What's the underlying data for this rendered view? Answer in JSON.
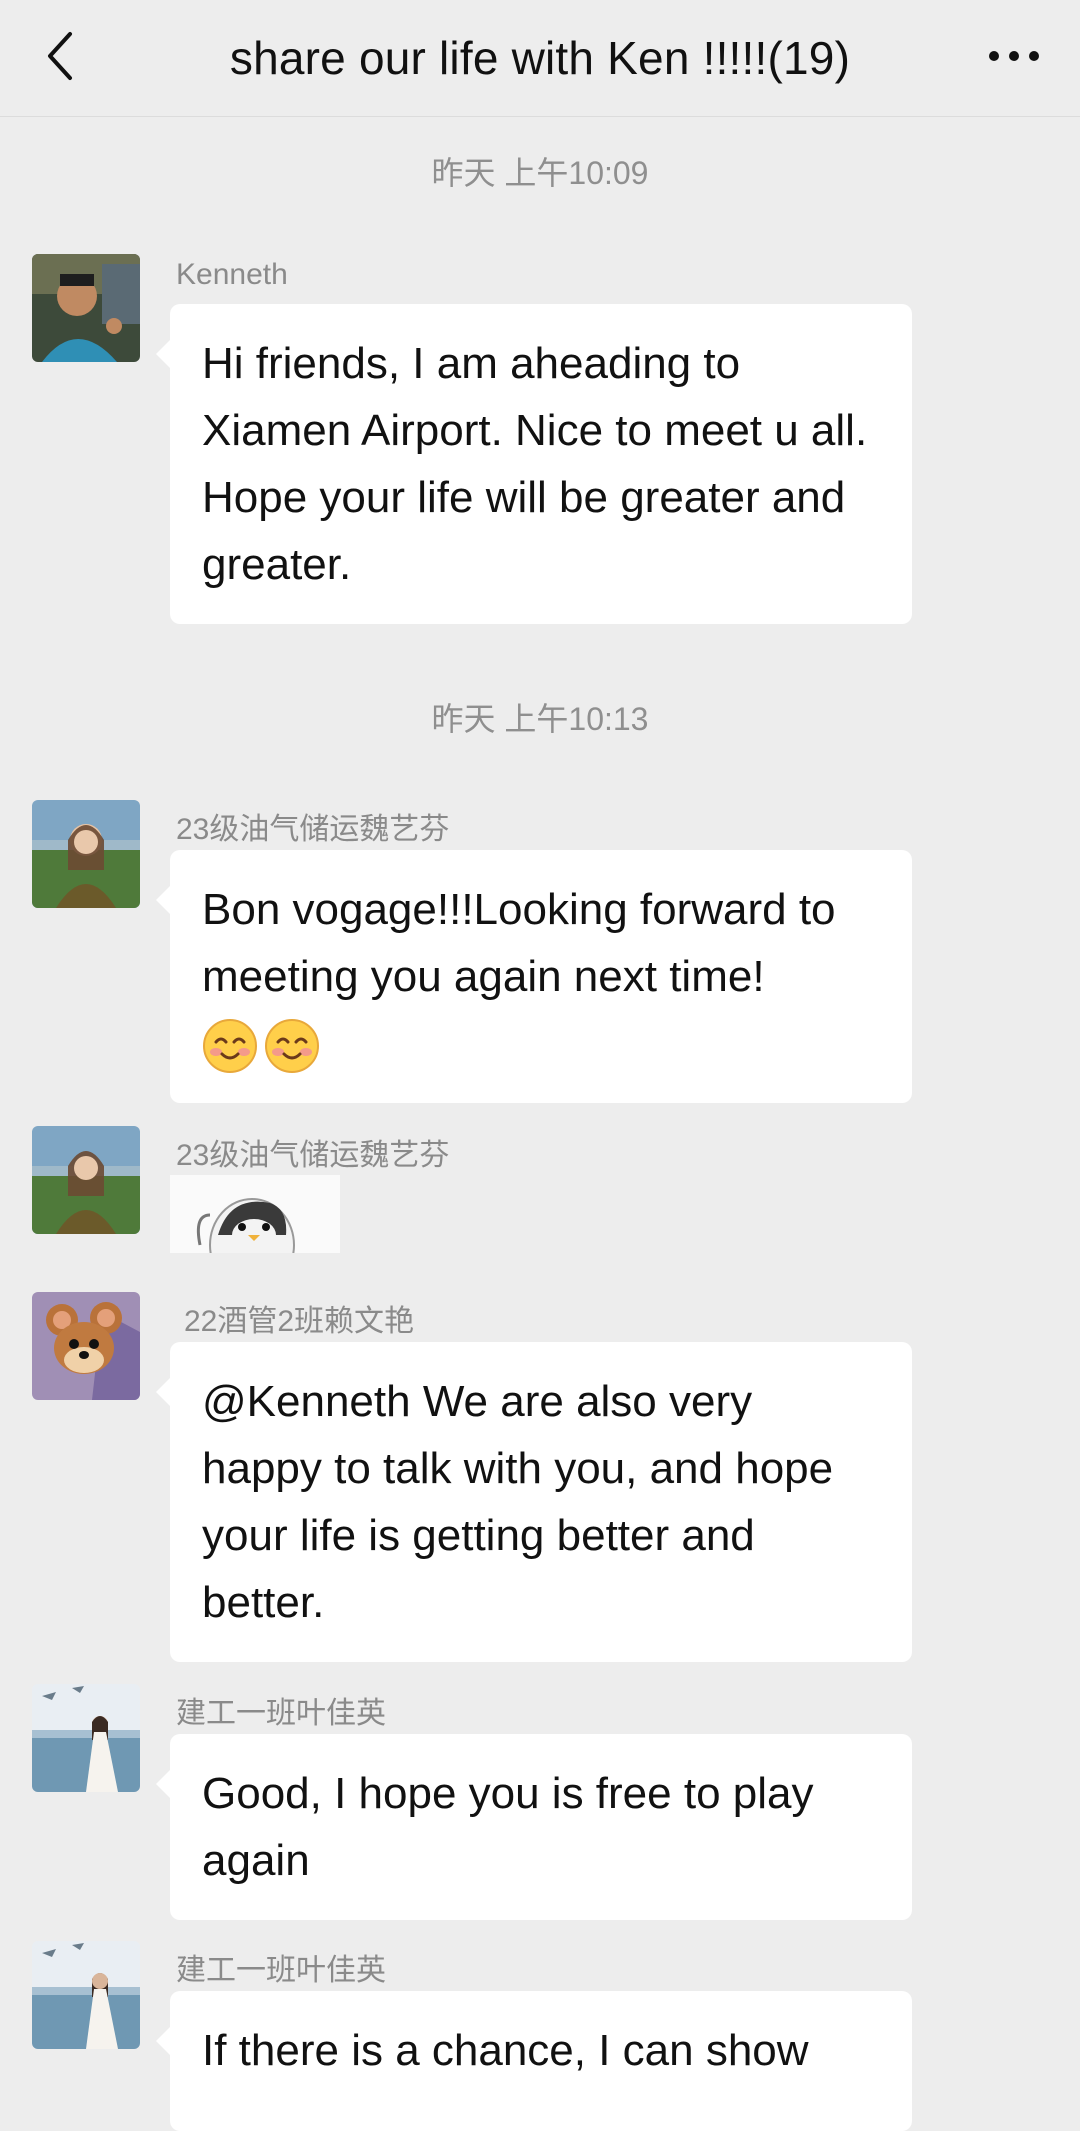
{
  "header": {
    "title": "share our life with Ken !!!!!(19)"
  },
  "timestamps": [
    "昨天 上午10:09",
    "昨天 上午10:13"
  ],
  "messages": [
    {
      "sender": "Kenneth",
      "text": "Hi friends, I am aheading to Xiamen Airport. Nice to meet u all. Hope your life will be greater and greater."
    },
    {
      "sender": "23级油气储运魏艺芬",
      "text": "Bon vogage!!!Looking forward to meeting  you  again next time!"
    },
    {
      "sender": "23级油气储运魏艺芬",
      "sticker": "penguin-sticker"
    },
    {
      "sender": "22酒管2班赖文艳",
      "text": "@Kenneth We are also very happy to talk with you, and hope your life is getting better and better."
    },
    {
      "sender": "建工一班叶佳英",
      "text": "Good, I hope you is free to play again"
    },
    {
      "sender": "建工一班叶佳英",
      "text": "If there is a chance, I can show"
    }
  ],
  "colors": {
    "background": "#ededed",
    "bubble": "#ffffff",
    "meta_text": "#8a8a8a"
  }
}
